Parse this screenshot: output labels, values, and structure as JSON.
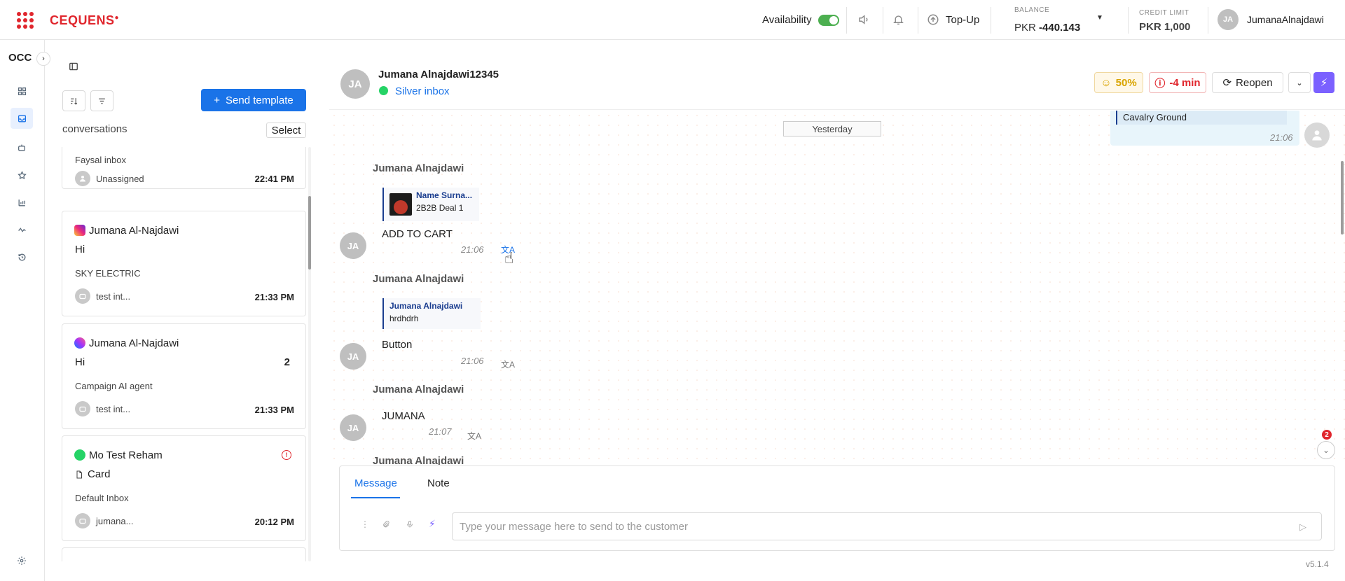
{
  "brand": {
    "logo_text": "CEQUENS",
    "color": "#e0262d"
  },
  "topbar": {
    "availability_label": "Availability",
    "topup_label": "Top-Up",
    "balance_caption": "BALANCE",
    "balance_currency": "PKR",
    "balance_value": "-440.143",
    "credit_caption": "CREDIT LIMIT",
    "credit_value": "PKR 1,000",
    "user_initials": "JA",
    "user_name": "JumanaAlnajdawi"
  },
  "rail": {
    "workspace": "OCC",
    "icons": [
      "dashboard-icon",
      "inbox-icon",
      "bot-icon",
      "star-icon",
      "chart-icon",
      "activity-icon",
      "history-icon"
    ],
    "settings_icon": "gear-icon"
  },
  "conversations": {
    "send_template_label": "Send template",
    "section_title": "conversations",
    "select_label": "Select",
    "cards": [
      {
        "inbox": "Faysal inbox",
        "agent": "Unassigned",
        "time": "22:41 PM"
      },
      {
        "name": "Jumana Al-Najdawi",
        "channel": "instagram",
        "message": "Hi",
        "inbox": "SKY ELECTRIC",
        "agent": "test int...",
        "time": "21:33 PM"
      },
      {
        "name": "Jumana Al-Najdawi",
        "channel": "messenger",
        "message": "Hi",
        "unread": "2",
        "inbox": "Campaign AI agent",
        "agent": "test int...",
        "time": "21:33 PM"
      },
      {
        "name": "Mo Test Reham",
        "channel": "whatsapp",
        "message": "Card",
        "inbox": "Default Inbox",
        "agent": "jumana...",
        "time": "20:12 PM"
      }
    ]
  },
  "chat": {
    "contact_initials": "JA",
    "contact_name": "Jumana Alnajdawi12345",
    "inbox_name": "Silver inbox",
    "score": "50%",
    "sla": "-4 min",
    "reopen_label": "Reopen",
    "date_divider": "Yesterday",
    "outgoing_snippet": "Cavalry Ground",
    "outgoing_time": "21:06",
    "messages": [
      {
        "sender": "Jumana Alnajdawi",
        "quote_title": "Name Surna...",
        "quote_body": "2B2B Deal 1",
        "text": "ADD TO CART",
        "time": "21:06"
      },
      {
        "sender": "Jumana Alnajdawi",
        "quote_title": "Jumana Alnajdawi",
        "quote_body": "hrdhdrh",
        "text": "Button",
        "time": "21:06"
      },
      {
        "sender": "Jumana Alnajdawi",
        "text": "JUMANA",
        "time": "21:07"
      },
      {
        "sender": "Jumana Alnajdawi"
      }
    ],
    "new_messages_badge": "2",
    "composer": {
      "tab_message": "Message",
      "tab_note": "Note",
      "placeholder": "Type your message here to send to the customer"
    },
    "version": "v5.1.4"
  },
  "colors": {
    "primary": "#1a73e8",
    "warning": "#d9a400",
    "danger": "#e0262d",
    "whatsapp": "#25d366"
  }
}
